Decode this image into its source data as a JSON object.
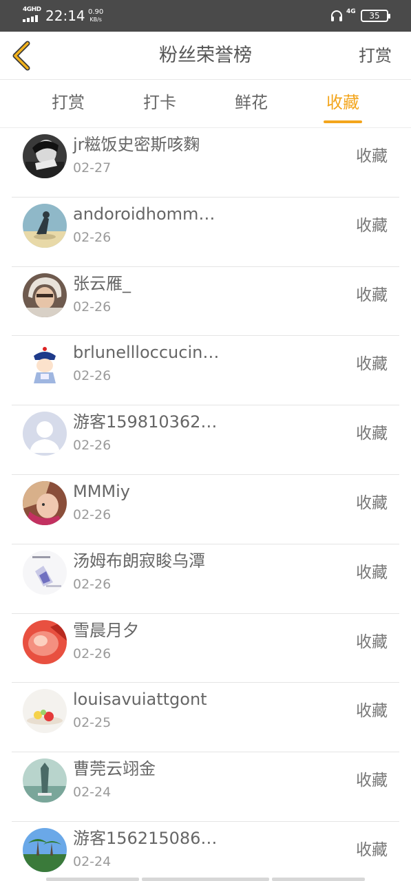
{
  "status_bar": {
    "network": "4GHD",
    "time": "22:14",
    "speed_value": "0.90",
    "speed_unit": "KB/s",
    "net_type": "4G",
    "battery": "35"
  },
  "header": {
    "title": "粉丝荣誉榜",
    "right_link": "打赏"
  },
  "tabs": [
    {
      "label": "打赏",
      "active": false
    },
    {
      "label": "打卡",
      "active": false
    },
    {
      "label": "鲜花",
      "active": false
    },
    {
      "label": "收藏",
      "active": true
    }
  ],
  "accent_color": "#f3a51c",
  "fans": [
    {
      "name": "jr糍饭史密斯咳麴",
      "date": "02-27",
      "action": "收藏"
    },
    {
      "name": "andoroidhomm…",
      "date": "02-26",
      "action": "收藏"
    },
    {
      "name": "张云雁_",
      "date": "02-26",
      "action": "收藏"
    },
    {
      "name": "brlunellloccucin…",
      "date": "02-26",
      "action": "收藏"
    },
    {
      "name": "游客159810362…",
      "date": "02-26",
      "action": "收藏"
    },
    {
      "name": "MMMiy",
      "date": "02-26",
      "action": "收藏"
    },
    {
      "name": "汤姆布朗寂睃乌潭",
      "date": "02-26",
      "action": "收藏"
    },
    {
      "name": "雪晨月夕",
      "date": "02-26",
      "action": "收藏"
    },
    {
      "name": "louisavuiattgont",
      "date": "02-25",
      "action": "收藏"
    },
    {
      "name": "曹莞云翊金",
      "date": "02-24",
      "action": "收藏"
    },
    {
      "name": "游客156215086…",
      "date": "02-24",
      "action": "收藏"
    }
  ]
}
